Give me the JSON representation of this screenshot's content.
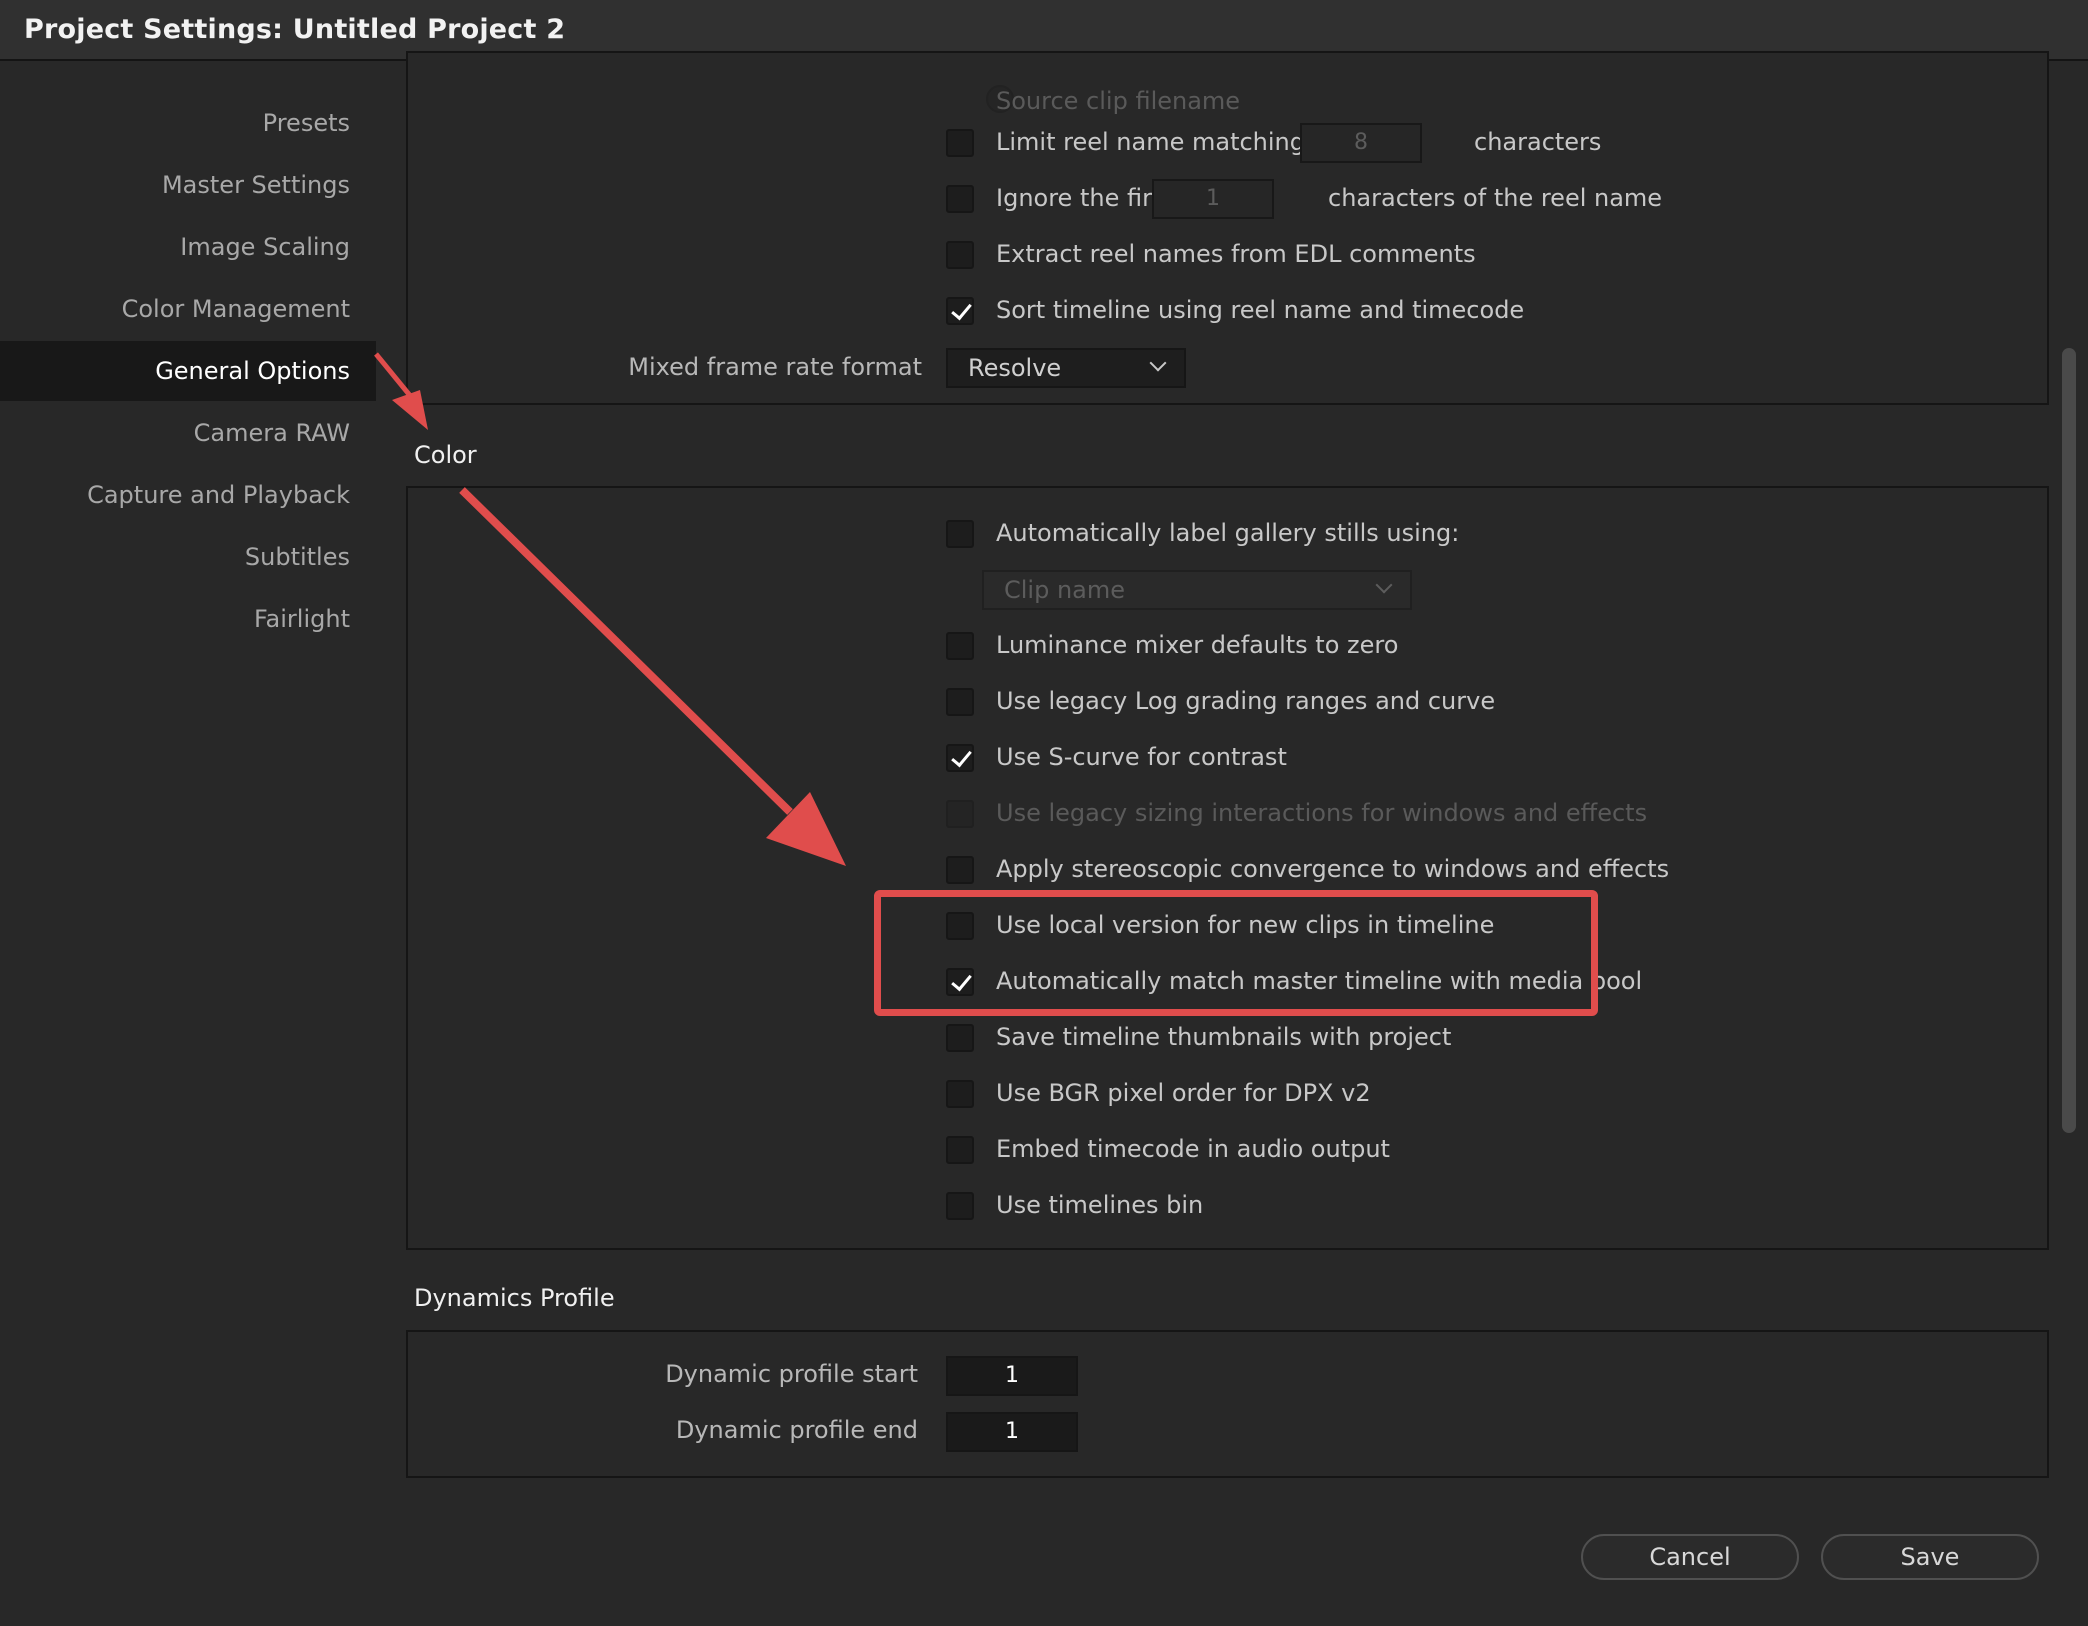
{
  "window": {
    "title": "Project Settings:  Untitled Project 2"
  },
  "sidebar": {
    "items": [
      {
        "label": "Presets"
      },
      {
        "label": "Master Settings"
      },
      {
        "label": "Image Scaling"
      },
      {
        "label": "Color Management"
      },
      {
        "label": "General Options",
        "active": true
      },
      {
        "label": "Camera RAW"
      },
      {
        "label": "Capture and Playback"
      },
      {
        "label": "Subtitles"
      },
      {
        "label": "Fairlight"
      }
    ]
  },
  "conform": {
    "source_clip_filename": "Source clip filename",
    "limit_reel": {
      "label": "Limit reel name matching to",
      "value": "8",
      "suffix": "characters",
      "checked": false
    },
    "ignore_first": {
      "label": "Ignore the first",
      "value": "1",
      "suffix": "characters of the reel name",
      "checked": false
    },
    "extract_reel": {
      "label": "Extract reel names from EDL comments",
      "checked": false
    },
    "sort_timeline": {
      "label": "Sort timeline using reel name and timecode",
      "checked": true
    },
    "mixed_frame_rate": {
      "label": "Mixed frame rate format",
      "value": "Resolve"
    }
  },
  "color_section": {
    "title": "Color",
    "auto_label": {
      "label": "Automatically label gallery stills using:",
      "checked": false
    },
    "gallery_select": {
      "value": "Clip name"
    },
    "options": [
      {
        "label": "Luminance mixer defaults to zero",
        "checked": false
      },
      {
        "label": "Use legacy Log grading ranges and curve",
        "checked": false
      },
      {
        "label": "Use S-curve for contrast",
        "checked": true
      },
      {
        "label": "Use legacy sizing interactions for windows and effects",
        "checked": false,
        "disabled": true
      },
      {
        "label": "Apply stereoscopic convergence to windows and effects",
        "checked": false
      },
      {
        "label": "Use local version for new clips in timeline",
        "checked": false
      },
      {
        "label": "Automatically match master timeline with media pool",
        "checked": true
      },
      {
        "label": "Save timeline thumbnails with project",
        "checked": false
      },
      {
        "label": "Use BGR pixel order for DPX v2",
        "checked": false
      },
      {
        "label": "Embed timecode in audio output",
        "checked": false
      },
      {
        "label": "Use timelines bin",
        "checked": false
      }
    ]
  },
  "dynamics": {
    "title": "Dynamics Profile",
    "start": {
      "label": "Dynamic profile start",
      "value": "1"
    },
    "end": {
      "label": "Dynamic profile end",
      "value": "1"
    }
  },
  "footer": {
    "cancel": "Cancel",
    "save": "Save"
  },
  "annotation": {
    "color": "#e04d4c"
  }
}
